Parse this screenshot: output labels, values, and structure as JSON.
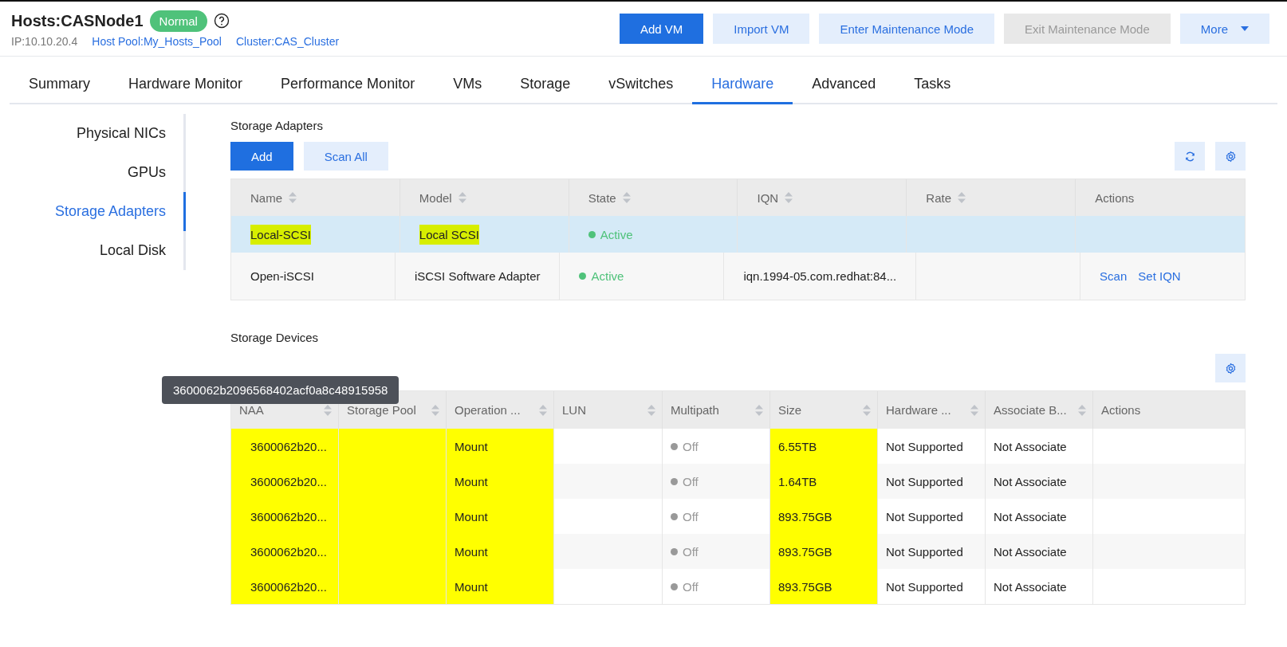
{
  "header": {
    "title": "Hosts:CASNode1",
    "status_badge": "Normal",
    "ip": "IP:10.10.20.4",
    "host_pool_link": "Host Pool:My_Hosts_Pool",
    "cluster_link": "Cluster:CAS_Cluster"
  },
  "actions": [
    {
      "label": "Add VM",
      "kind": "primary",
      "disabled": false
    },
    {
      "label": "Import VM",
      "kind": "secondary",
      "disabled": false
    },
    {
      "label": "Enter Maintenance Mode",
      "kind": "secondary",
      "disabled": false
    },
    {
      "label": "Exit Maintenance Mode",
      "kind": "secondary",
      "disabled": true
    },
    {
      "label": "More",
      "kind": "dropdown",
      "disabled": false
    }
  ],
  "tabs": [
    {
      "label": "Summary",
      "selected": false
    },
    {
      "label": "Hardware Monitor",
      "selected": false
    },
    {
      "label": "Performance Monitor",
      "selected": false
    },
    {
      "label": "VMs",
      "selected": false
    },
    {
      "label": "Storage",
      "selected": false
    },
    {
      "label": "vSwitches",
      "selected": false
    },
    {
      "label": "Hardware",
      "selected": true
    },
    {
      "label": "Advanced",
      "selected": false
    },
    {
      "label": "Tasks",
      "selected": false
    }
  ],
  "sidebar": {
    "items": [
      {
        "label": "Physical NICs",
        "selected": false
      },
      {
        "label": "GPUs",
        "selected": false
      },
      {
        "label": "Storage Adapters",
        "selected": true
      },
      {
        "label": "Local Disk",
        "selected": false
      }
    ]
  },
  "storage_adapters": {
    "title": "Storage Adapters",
    "buttons": [
      {
        "label": "Add",
        "kind": "primary"
      },
      {
        "label": "Scan All",
        "kind": "secondary"
      }
    ],
    "columns": [
      {
        "label": "Name",
        "sortable": true
      },
      {
        "label": "Model",
        "sortable": true
      },
      {
        "label": "State",
        "sortable": true
      },
      {
        "label": "IQN",
        "sortable": true
      },
      {
        "label": "Rate",
        "sortable": true
      },
      {
        "label": "Actions",
        "sortable": false
      }
    ],
    "rows": [
      {
        "name": "Local-SCSI",
        "model": "Local SCSI",
        "state": "Active",
        "active": true,
        "iqn": "",
        "rate": "",
        "actions": [],
        "selected": true,
        "highlighted": true
      },
      {
        "name": "Open-iSCSI",
        "model": "iSCSI Software Adapter",
        "state": "Active",
        "active": true,
        "iqn": "iqn.1994-05.com.redhat:84...",
        "rate": "",
        "actions": [
          "Scan",
          "Set IQN"
        ],
        "selected": false,
        "highlighted": false
      }
    ]
  },
  "storage_devices": {
    "title": "Storage Devices",
    "tooltip": "3600062b2096568402acf0a8c48915958",
    "columns": [
      {
        "label": "NAA",
        "sortable": true
      },
      {
        "label": "Storage Pool",
        "sortable": true
      },
      {
        "label": "Operation ...",
        "sortable": true
      },
      {
        "label": "LUN",
        "sortable": true
      },
      {
        "label": "Multipath",
        "sortable": true
      },
      {
        "label": "Size",
        "sortable": true
      },
      {
        "label": "Hardware ...",
        "sortable": true
      },
      {
        "label": "Associate B...",
        "sortable": true
      },
      {
        "label": "Actions",
        "sortable": false
      }
    ],
    "rows": [
      {
        "naa": "3600062b20...",
        "operation": "Mount",
        "multipath": "Off",
        "multipath_on": false,
        "size": "6.55TB",
        "hardware": "Not Supported",
        "associate": "Not Associate",
        "highlighted": true
      },
      {
        "naa": "3600062b20...",
        "operation": "Mount",
        "multipath": "Off",
        "multipath_on": false,
        "size": "1.64TB",
        "hardware": "Not Supported",
        "associate": "Not Associate",
        "highlighted": true
      },
      {
        "naa": "3600062b20...",
        "operation": "Mount",
        "multipath": "Off",
        "multipath_on": false,
        "size": "893.75GB",
        "hardware": "Not Supported",
        "associate": "Not Associate",
        "highlighted": true
      },
      {
        "naa": "3600062b20...",
        "operation": "Mount",
        "multipath": "Off",
        "multipath_on": false,
        "size": "893.75GB",
        "hardware": "Not Supported",
        "associate": "Not Associate",
        "highlighted": true
      },
      {
        "naa": "3600062b20...",
        "operation": "Mount",
        "multipath": "Off",
        "multipath_on": false,
        "size": "893.75GB",
        "hardware": "Not Supported",
        "associate": "Not Associate",
        "highlighted": true
      }
    ]
  }
}
